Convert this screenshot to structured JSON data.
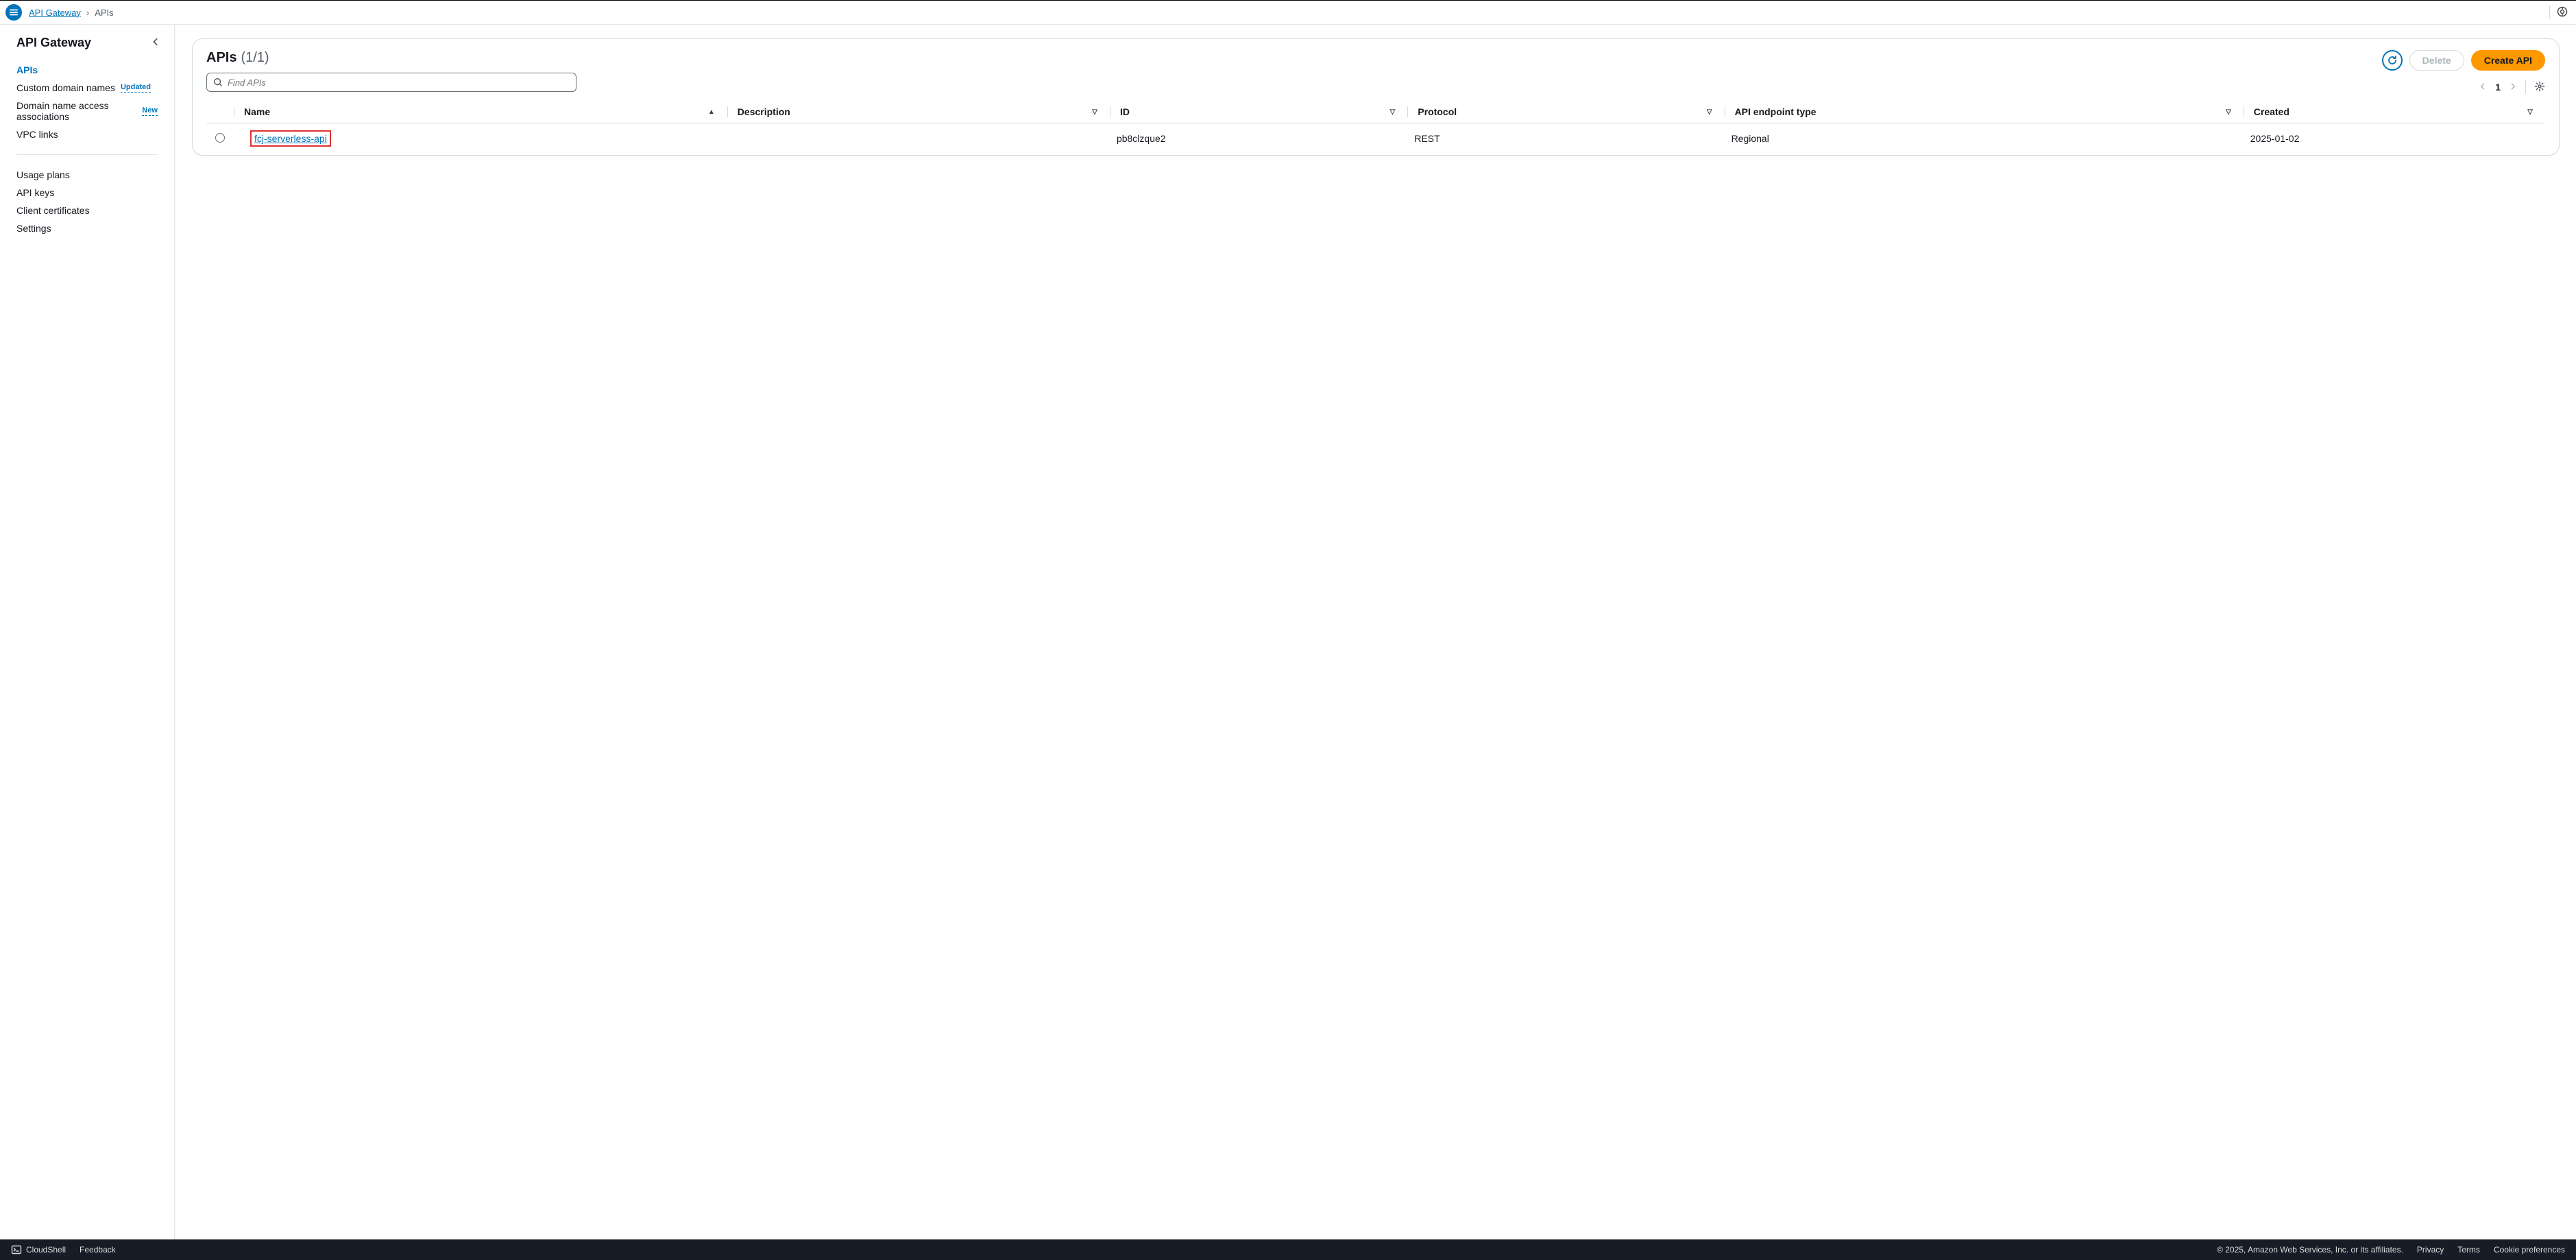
{
  "breadcrumb": {
    "root": "API Gateway",
    "current": "APIs"
  },
  "sidebar": {
    "title": "API Gateway",
    "group1": [
      {
        "label": "APIs",
        "active": true
      },
      {
        "label": "Custom domain names",
        "badge": "Updated"
      },
      {
        "label": "Domain name access associations",
        "badge": "New"
      },
      {
        "label": "VPC links"
      }
    ],
    "group2": [
      {
        "label": "Usage plans"
      },
      {
        "label": "API keys"
      },
      {
        "label": "Client certificates"
      },
      {
        "label": "Settings"
      }
    ]
  },
  "panel": {
    "title": "APIs",
    "count": "(1/1)",
    "delete_label": "Delete",
    "create_label": "Create API",
    "search_placeholder": "Find APIs",
    "page": "1"
  },
  "table": {
    "columns": [
      "Name",
      "Description",
      "ID",
      "Protocol",
      "API endpoint type",
      "Created"
    ],
    "rows": [
      {
        "name": "fcj-serverless-api",
        "description": "",
        "id": "pb8clzque2",
        "protocol": "REST",
        "endpoint_type": "Regional",
        "created": "2025-01-02"
      }
    ]
  },
  "footer": {
    "cloudshell": "CloudShell",
    "feedback": "Feedback",
    "copyright": "© 2025, Amazon Web Services, Inc. or its affiliates.",
    "privacy": "Privacy",
    "terms": "Terms",
    "cookies": "Cookie preferences"
  }
}
